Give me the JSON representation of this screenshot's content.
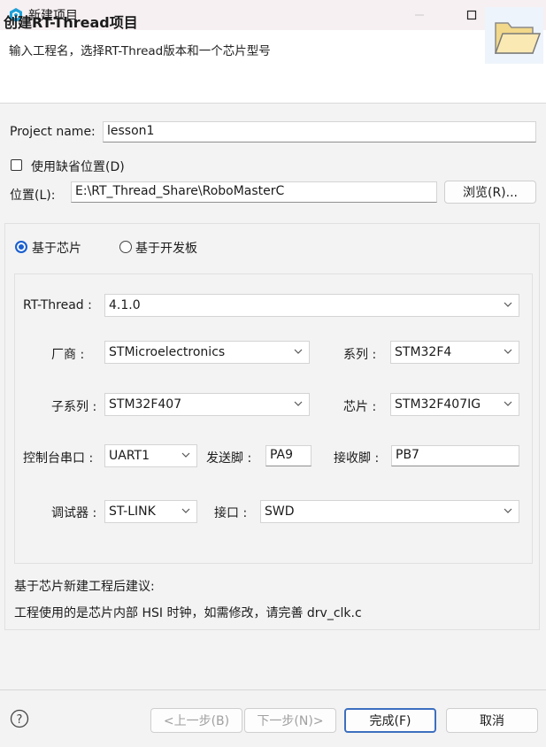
{
  "window": {
    "title": "新建项目",
    "minimize_icon": "minimize-icon",
    "maximize_icon": "maximize-icon",
    "close_icon": "close-icon"
  },
  "header": {
    "title": "创建RT-Thread项目",
    "subtitle": "输入工程名，选择RT-Thread版本和一个芯片型号"
  },
  "project": {
    "name_label": "Project name:",
    "name_value": "lesson1",
    "default_location_label": "使用缺省位置(D)",
    "default_location_checked": false,
    "location_label": "位置(L):",
    "location_value": "E:\\RT_Thread_Share\\RoboMasterC",
    "browse_label": "浏览(R)..."
  },
  "mode": {
    "chip_label": "基于芯片",
    "board_label": "基于开发板",
    "selected": "chip"
  },
  "config": {
    "rtthread_label": "RT-Thread :",
    "rtthread_value": "4.1.0",
    "vendor_label": "厂商 :",
    "vendor_value": "STMicroelectronics",
    "series_label": "系列 :",
    "series_value": "STM32F4",
    "subseries_label": "子系列 :",
    "subseries_value": "STM32F407",
    "chip_label": "芯片 :",
    "chip_value": "STM32F407IG",
    "console_label": "控制台串口 :",
    "console_value": "UART1",
    "tx_label": "发送脚 :",
    "tx_value": "PA9",
    "rx_label": "接收脚 :",
    "rx_value": "PB7",
    "debugger_label": "调试器 :",
    "debugger_value": "ST-LINK",
    "interface_label": "接口 :",
    "interface_value": "SWD"
  },
  "advice": {
    "heading": "基于芯片新建工程后建议:",
    "text": "工程使用的是芯片内部 HSI 时钟，如需修改，请完善 drv_clk.c"
  },
  "footer": {
    "help_icon": "help-icon",
    "back_label": "<上一步(B)",
    "next_label": "下一步(N)>",
    "finish_label": "完成(F)",
    "cancel_label": "取消"
  },
  "colors": {
    "accent": "#1a5fd0",
    "titlebar": "#f7f0f2",
    "primary_border": "#3d6fbf"
  }
}
